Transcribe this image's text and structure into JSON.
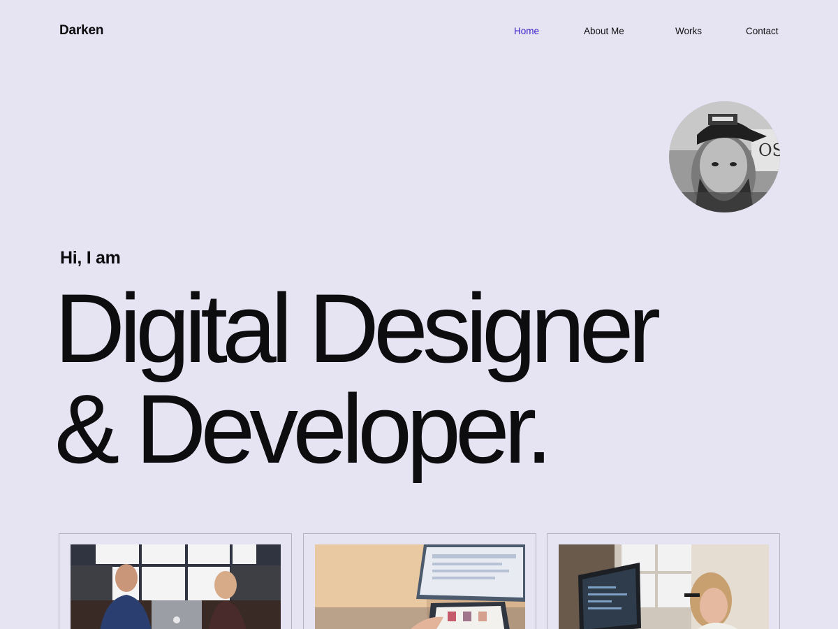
{
  "header": {
    "brand": "Darken",
    "nav": [
      {
        "label": "Home",
        "active": true
      },
      {
        "label": "About Me",
        "active": false
      },
      {
        "label": "Works",
        "active": false
      },
      {
        "label": "Contact",
        "active": false
      }
    ]
  },
  "hero": {
    "greeting": "Hi, I am",
    "headline_line1": "Digital Designer",
    "headline_line2": "& Developer."
  },
  "projects": [
    {
      "image": "photo-two-people-laptop"
    },
    {
      "image": "photo-hands-tablet"
    },
    {
      "image": "photo-woman-at-monitor"
    }
  ],
  "colors": {
    "background": "#e6e4f3",
    "text": "#0d0d0f",
    "accent": "#3c1ec8",
    "card_border": "#b4b2c2"
  }
}
